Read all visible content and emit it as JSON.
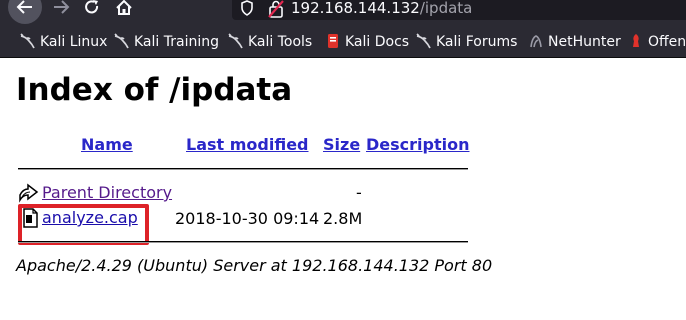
{
  "browser": {
    "url_host": "192.168.144.132",
    "url_path": "/ipdata",
    "bookmarks": [
      {
        "label": "Kali Linux",
        "icon": "kali-dragon-icon"
      },
      {
        "label": "Kali Training",
        "icon": "kali-dragon-icon"
      },
      {
        "label": "Kali Tools",
        "icon": "kali-dragon-icon"
      },
      {
        "label": "Kali Docs",
        "icon": "kali-docs-icon"
      },
      {
        "label": "Kali Forums",
        "icon": "kali-dragon-icon"
      },
      {
        "label": "NetHunter",
        "icon": "nethunter-icon"
      },
      {
        "label": "Offen",
        "icon": "offsec-icon"
      }
    ]
  },
  "page": {
    "title": "Index of /ipdata",
    "columns": {
      "name": "Name",
      "last_modified": "Last modified",
      "size": "Size",
      "description": "Description"
    },
    "rows": [
      {
        "name": "Parent Directory",
        "icon": "parent-dir-icon",
        "last_modified": "",
        "size": "-",
        "description": ""
      },
      {
        "name": "analyze.cap",
        "icon": "file-icon",
        "last_modified": "2018-10-30 09:14",
        "size": "2.8M",
        "description": ""
      }
    ],
    "footer": "Apache/2.4.29 (Ubuntu) Server at 192.168.144.132 Port 80"
  },
  "colors": {
    "chrome_bg": "#2b2a33",
    "link": "#1a0dab",
    "visited_link": "#551a8b",
    "highlight_box": "#dd2228"
  }
}
